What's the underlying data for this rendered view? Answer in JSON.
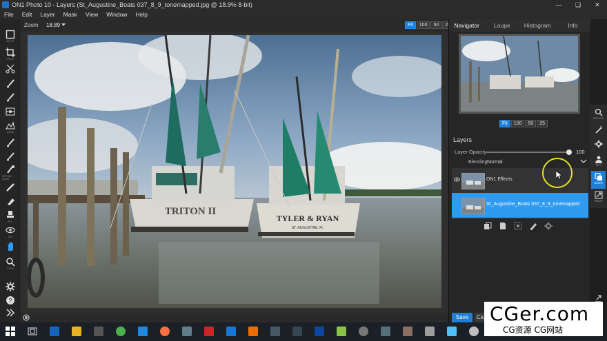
{
  "window": {
    "title": "ON1 Photo 10 - Layers (St_Augustine_Boats 037_8_9_tonemapped.jpg @ 18.9% 8-bit)"
  },
  "menu": [
    "File",
    "Edit",
    "Layer",
    "Mask",
    "View",
    "Window",
    "Help"
  ],
  "toolbar": {
    "tools": [
      {
        "name": "transform",
        "label": "MOVE"
      },
      {
        "name": "crop",
        "label": "CROP"
      },
      {
        "name": "cut",
        "label": ""
      },
      {
        "name": "brush",
        "label": ""
      },
      {
        "name": "brush2",
        "label": ""
      },
      {
        "name": "adjust",
        "label": ""
      },
      {
        "name": "mask",
        "label": "MASK"
      },
      {
        "name": "refine",
        "label": ""
      },
      {
        "name": "refine2",
        "label": ""
      },
      {
        "name": "refine3",
        "label": "REFINE MASK"
      },
      {
        "name": "retouch",
        "label": ""
      },
      {
        "name": "retouch2",
        "label": ""
      },
      {
        "name": "retouch3",
        "label": "FIX"
      },
      {
        "name": "redeye",
        "label": "RD"
      },
      {
        "name": "hand",
        "label": ""
      },
      {
        "name": "zoom",
        "label": "VIEW"
      }
    ]
  },
  "zoombar": {
    "label": "Zoom",
    "value": "18.89",
    "buttons": [
      "Fit",
      "100",
      "50",
      "25"
    ],
    "active": "Fit"
  },
  "panel": {
    "tabs": [
      "Navigator",
      "Loupe",
      "Histogram",
      "Info"
    ],
    "active_tab": "Navigator",
    "nav_buttons": [
      "Fit",
      "100",
      "50",
      "25"
    ],
    "layers_header": "Layers",
    "opacity_label": "Layer Opacity",
    "opacity_value": "100",
    "opacity_fraction": 1.0,
    "blending_label": "Blending",
    "blending_value": "Normal",
    "layers": [
      {
        "name": "ON1 Effects",
        "selected": false
      },
      {
        "name": "St_Augustine_Boats 037_8_9_tonemapped",
        "selected": true
      }
    ],
    "save_label": "Save",
    "cancel_label": "Ca"
  },
  "modules": [
    {
      "name": "browse",
      "label": "BROWSE"
    },
    {
      "name": "develop",
      "label": ""
    },
    {
      "name": "effects",
      "label": ""
    },
    {
      "name": "portrait",
      "label": "EDIT"
    },
    {
      "name": "layers",
      "label": "LAYERS"
    },
    {
      "name": "resize",
      "label": "RESIZE"
    }
  ],
  "photo": {
    "boat1_name": "TRITON II",
    "boat2_name": "TYLER & RYAN",
    "boat2_port": "ST. AUGUSTINE, FL"
  },
  "watermark": {
    "line1": "CGer.com",
    "line2": "CG资源 CG网站"
  },
  "colors": {
    "accent": "#1f7fd4",
    "selected_layer": "#2f9bf0",
    "highlight_circle": "#e7e229"
  }
}
